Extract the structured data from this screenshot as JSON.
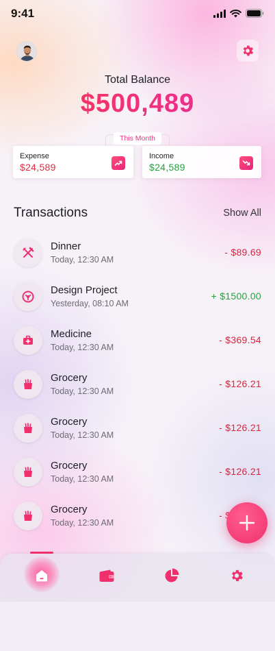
{
  "status_bar": {
    "time": "9:41"
  },
  "header": {
    "balance_title": "Total Balance",
    "balance_amount": "$500,489"
  },
  "summary": {
    "period_label": "This Month",
    "expense": {
      "label": "Expense",
      "value": "$24,589"
    },
    "income": {
      "label": "Income",
      "value": "$24,589"
    }
  },
  "transactions": {
    "title": "Transactions",
    "show_all": "Show All",
    "items": [
      {
        "name": "Dinner",
        "time": "Today, 12:30 AM",
        "amount": "- $89.69",
        "icon": "fork-knife-icon"
      },
      {
        "name": "Design Project",
        "time": "Yesterday, 08:10 AM",
        "amount": "+ $1500.00",
        "icon": "design-icon"
      },
      {
        "name": "Medicine",
        "time": "Today, 12:30 AM",
        "amount": "- $369.54",
        "icon": "medkit-icon"
      },
      {
        "name": "Grocery",
        "time": "Today, 12:30 AM",
        "amount": "- $126.21",
        "icon": "grocery-bag-icon"
      },
      {
        "name": "Grocery",
        "time": "Today, 12:30 AM",
        "amount": "- $126.21",
        "icon": "grocery-bag-icon"
      },
      {
        "name": "Grocery",
        "time": "Today, 12:30 AM",
        "amount": "- $126.21",
        "icon": "grocery-bag-icon"
      },
      {
        "name": "Grocery",
        "time": "Today, 12:30 AM",
        "amount": "- $126.21",
        "icon": "grocery-bag-icon"
      }
    ]
  },
  "nav": {
    "items": [
      "home-icon",
      "wallet-icon",
      "pie-chart-icon",
      "gear-icon"
    ],
    "active": "home-icon"
  },
  "colors": {
    "accent": "#f0306d",
    "negative": "#e0203c",
    "positive": "#23a33d"
  }
}
